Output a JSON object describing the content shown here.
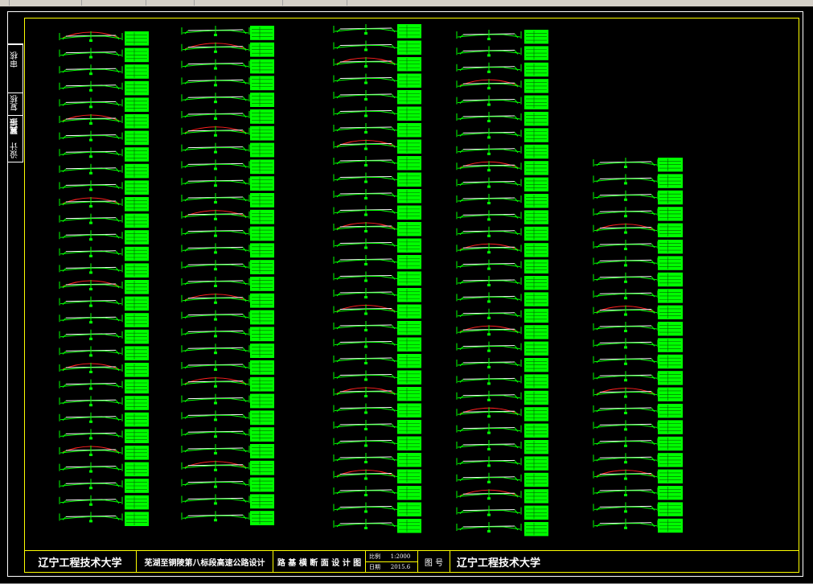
{
  "colors": {
    "background": "#000000",
    "frame": "#ffff00",
    "outer_frame": "#ffffff",
    "section_line": "#00ff00",
    "table_fill": "#00ff00",
    "cut_line": "#ff2020",
    "road_line": "#ffffff",
    "text": "#ffffff"
  },
  "icons": [
    "file-icon",
    "print-icon",
    "zoom-icon",
    "pan-icon",
    "layer-icon",
    "properties-icon"
  ],
  "left_stamp": {
    "review": "审核",
    "check": "复核",
    "name": "翼振",
    "design": "设计"
  },
  "title_block": {
    "university": "辽宁工程技术大学",
    "project": "芜湖至铜陵第八标段高速公路设计",
    "drawing_title": "路 基 横 断 面 设 计 图",
    "scale_label": "比例",
    "scale_value": "1:2000",
    "date_label": "日期",
    "date_value": "2015.6",
    "figure_label": "图 号",
    "university_right": "辽宁工程技术大学"
  },
  "columns": [
    {
      "name": "column-1",
      "sections": 30
    },
    {
      "name": "column-2",
      "sections": 30
    },
    {
      "name": "column-3",
      "sections": 31
    },
    {
      "name": "column-4",
      "sections": 31
    },
    {
      "name": "column-5",
      "sections": 23
    }
  ]
}
